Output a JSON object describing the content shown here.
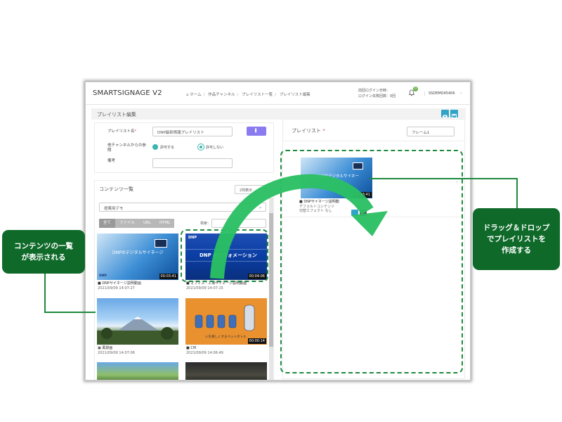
{
  "header": {
    "brand": "SMARTSIGNAGE V2",
    "breadcrumb": [
      "ホーム",
      "作品チャンネル",
      "プレイリスト一覧",
      "プレイリスト編集"
    ],
    "last_login_label": "前回ログイン日時：",
    "failed_login_label": "ログイン失敗回数：0回",
    "notification_count": "0",
    "user": "SSDEMO45406"
  },
  "subheader": {
    "title": "プレイリスト編集"
  },
  "form": {
    "name_label": "プレイリスト名",
    "name_required_mark": "*",
    "name_value": "DNP最新情報プレイリスト",
    "ref_label": "他チャンネルからの参照",
    "ref_option_allow": "許可する",
    "ref_option_deny": "許可しない",
    "note_label": "備考"
  },
  "content_list": {
    "title": "コンテンツ一覧",
    "columns_value": "2列表示",
    "folder_value": "提案用デモ",
    "filters": [
      "全て",
      "ファイル",
      "URL",
      "HTML"
    ],
    "search_label": "検索：",
    "items": [
      {
        "duration": "00:03:41",
        "name": "DNPサイネージ説明動画",
        "date": "2021/09/09 14:07:27",
        "icon": "video-icon"
      },
      {
        "duration": "00:04:06",
        "name": "オフィス・工場サイネージ説明動画",
        "date": "2021/09/09 14:07:15",
        "icon": "video-icon"
      },
      {
        "duration": "",
        "name": "風景画",
        "date": "2021/09/09 14:07:06",
        "icon": "image-icon"
      },
      {
        "duration": "00:00:14",
        "name": "CM",
        "date": "2021/09/09 14:06:49",
        "icon": "video-icon"
      }
    ],
    "thumb_text_1": "DNPのデジタルサイネージ",
    "thumb_logo": "DNP",
    "thumb_text_2": "DNP インフォメーション",
    "thumb_text_4": "いを楽しくするペットボトル"
  },
  "playlist": {
    "title": "プレイリスト",
    "required_mark": "*",
    "frame_value": "フレーム1",
    "item": {
      "duration": "00:03:41",
      "name": "DNPサイネージ説明動",
      "line2": "デフォルトコンテンツ",
      "line3": "切替エフェクト なし",
      "thumb_text": "DNPのデジタルサイネー"
    }
  },
  "callouts": {
    "left": [
      "コンテンツの一覧",
      "が表示される"
    ],
    "right": [
      "ドラッグ＆ドロップ",
      "でプレイリストを",
      "作成する"
    ]
  },
  "colors": {
    "accent_green": "#0f6a2a",
    "dash_green": "#1e8a3c",
    "arrow_green": "#2bbf63",
    "teal": "#3cb5b0",
    "blue_btn": "#31a3c9"
  }
}
